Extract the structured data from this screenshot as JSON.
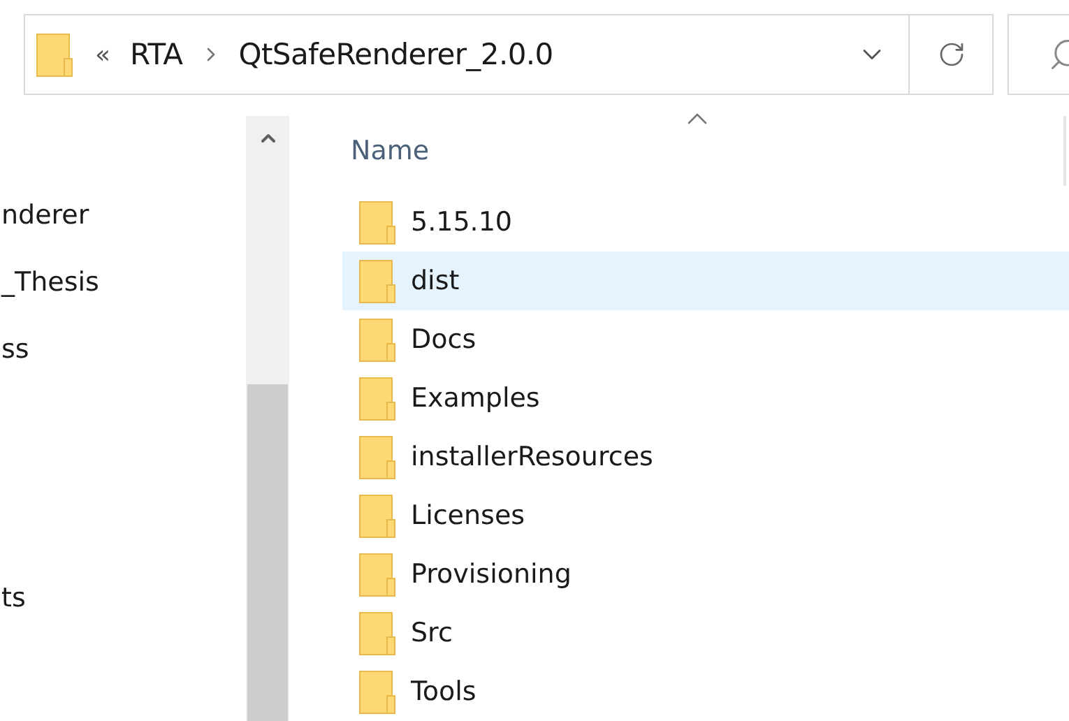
{
  "address_bar": {
    "overflow": "«",
    "path": [
      "RTA",
      "QtSafeRenderer_2.0.0"
    ]
  },
  "nav_pane": {
    "items": [
      {
        "label": "nderer"
      },
      {
        "label": "_Thesis"
      },
      {
        "label": "ss"
      },
      {
        "label": "ts"
      }
    ]
  },
  "file_list": {
    "columns": [
      {
        "label": "Name",
        "sorted": true
      }
    ],
    "rows": [
      {
        "name": "5.15.10",
        "selected": false
      },
      {
        "name": "dist",
        "selected": true
      },
      {
        "name": "Docs",
        "selected": false
      },
      {
        "name": "Examples",
        "selected": false
      },
      {
        "name": "installerResources",
        "selected": false
      },
      {
        "name": "Licenses",
        "selected": false
      },
      {
        "name": "Provisioning",
        "selected": false
      },
      {
        "name": "Src",
        "selected": false
      },
      {
        "name": "Tools",
        "selected": false
      }
    ]
  }
}
